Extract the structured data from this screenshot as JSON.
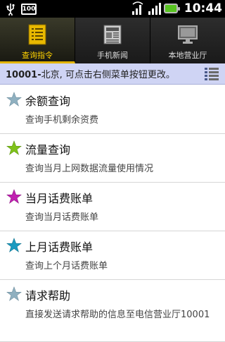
{
  "status_bar": {
    "usb_icon": "usb-icon",
    "battery_percent": "100",
    "wifi_icon": "wifi-icon",
    "signal_icon": "signal-icon",
    "battery_icon": "battery-icon",
    "time": "10:44"
  },
  "tabs": [
    {
      "label": "查询指令",
      "icon": "list-icon",
      "active": true
    },
    {
      "label": "手机新闻",
      "icon": "newspaper-icon",
      "active": false
    },
    {
      "label": "本地营业厅",
      "icon": "monitor-icon",
      "active": false
    }
  ],
  "info_bar": {
    "code": "10001-",
    "text": "北京, 可点击右侧菜单按钮更改。",
    "menu_icon": "menu-list-icon"
  },
  "items": [
    {
      "title": "余额查询",
      "desc": "查询手机剩余资费",
      "star_color": "#8fb0c0"
    },
    {
      "title": "流量查询",
      "desc": "查询当月上网数据流量使用情况",
      "star_color": "#7fc21a"
    },
    {
      "title": "当月话费账单",
      "desc": "查询当月话费账单",
      "star_color": "#c020b0"
    },
    {
      "title": "上月话费账单",
      "desc": "查询上个月话费账单",
      "star_color": "#1a9ac0"
    },
    {
      "title": "请求帮助",
      "desc": "直接发送请求帮助的信息至电信营业厅10001",
      "star_color": "#8fb0c0"
    }
  ],
  "colors": {
    "active_tab": "#ffd200",
    "info_bar_bg": "#cfd4f4"
  }
}
